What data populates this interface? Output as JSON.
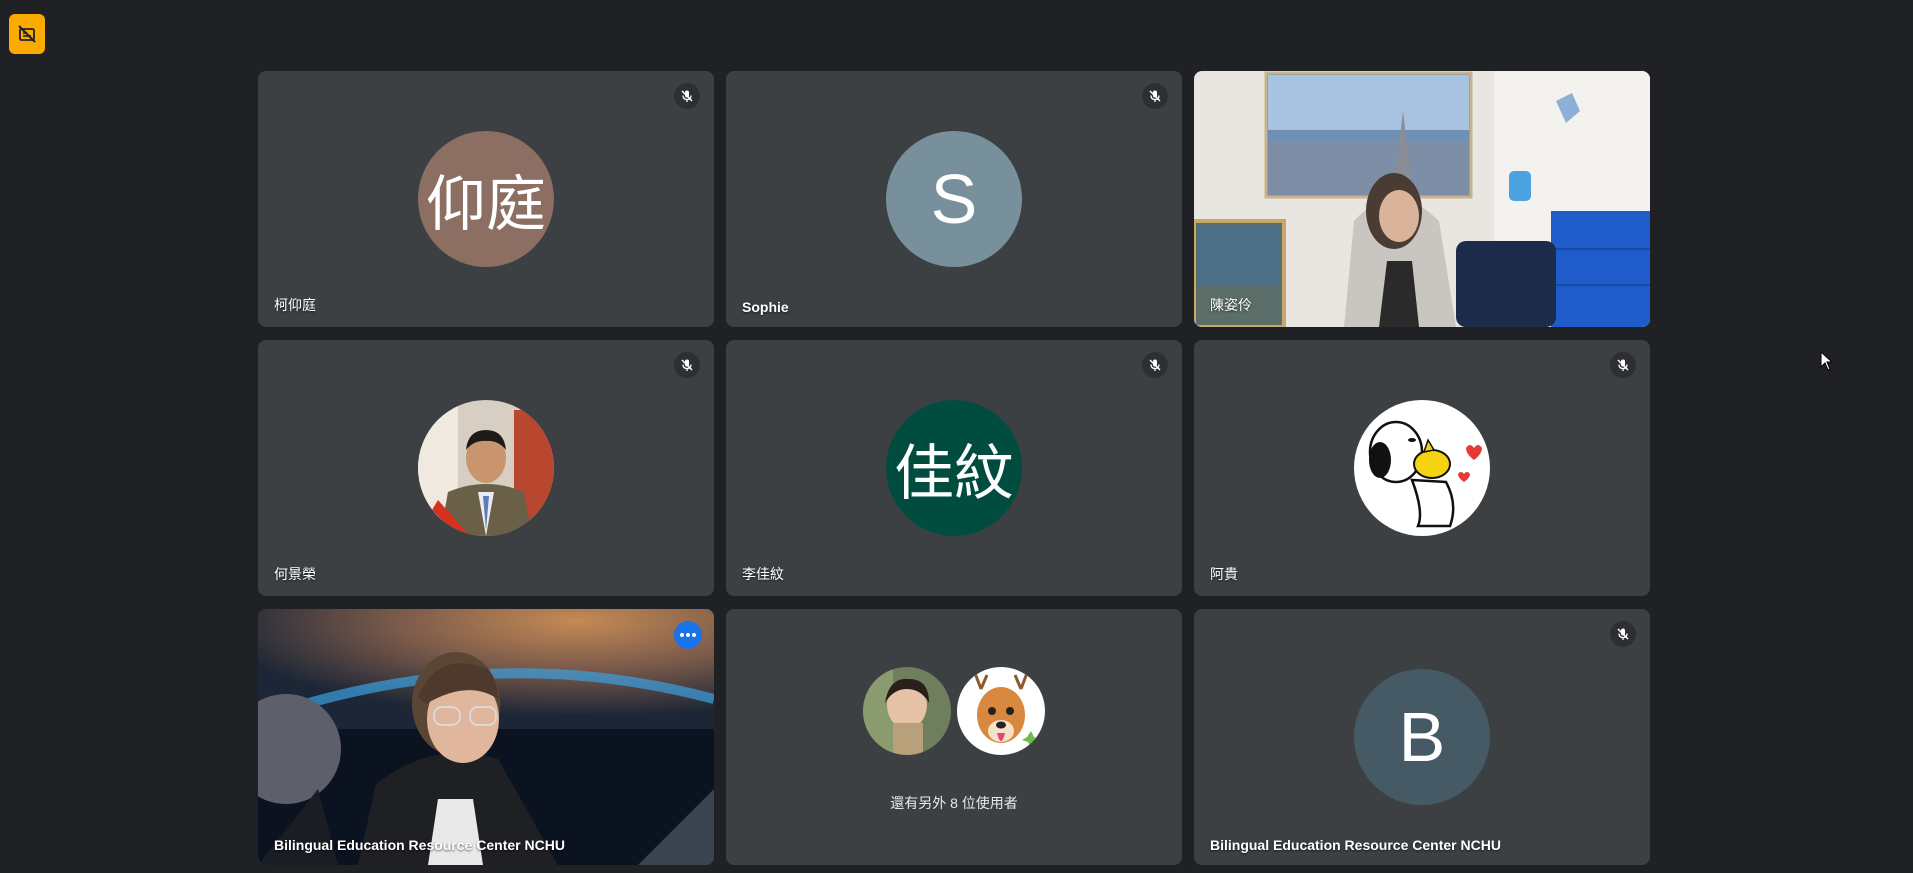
{
  "colors": {
    "background": "#202124",
    "tile": "#3c4043",
    "active_border": "#8ab4f8",
    "badge": "#f9ab00",
    "more_button": "#1a73e8"
  },
  "toolbar": {
    "badge_icon": "captions-off-icon"
  },
  "tiles": [
    {
      "name": "柯仰庭",
      "avatar_text": "仰庭",
      "avatar_color": "#8d6e63",
      "muted": true
    },
    {
      "name": "Sophie",
      "avatar_text": "S",
      "avatar_color": "#78909c",
      "muted": true
    },
    {
      "name": "陳姿伶",
      "type": "video",
      "muted": false
    },
    {
      "name": "何景榮",
      "type": "photo-avatar",
      "muted": true
    },
    {
      "name": "李佳紋",
      "avatar_text": "佳紋",
      "avatar_color": "#004d40",
      "muted": true
    },
    {
      "name": "阿貴",
      "type": "photo-avatar",
      "muted": true
    },
    {
      "name": "Bilingual Education Resource Center NCHU",
      "type": "video",
      "active": true,
      "more_icon": "more-options-icon"
    },
    {
      "type": "others",
      "label": "還有另外 8 位使用者"
    },
    {
      "name": "Bilingual Education Resource Center NCHU",
      "avatar_text": "B",
      "avatar_color": "#455a64",
      "muted": true
    }
  ]
}
